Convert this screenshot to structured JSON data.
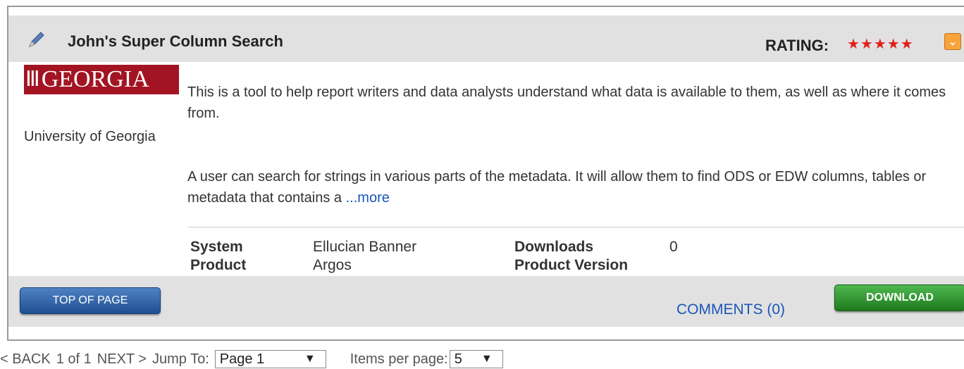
{
  "card": {
    "title": "John's Super Column Search",
    "rating_label": "RATING:",
    "rating_stars": 5,
    "stars_text": "★★★★★",
    "logo_text": "GEORGIA",
    "organization": "University of Georgia",
    "description_1": "This is a tool to help report writers and data analysts understand what data is available to them, as well as where it comes from.",
    "description_2": "A user can search for strings in various parts of the metadata. It will allow them to find ODS or EDW columns, tables or metadata that contains a",
    "more_link": "...more",
    "info": {
      "system_label": "System",
      "system_value": "Ellucian Banner",
      "product_label": "Product",
      "product_value": "Argos",
      "downloads_label": "Downloads",
      "downloads_value": "0",
      "version_label": "Product Version",
      "version_value": ""
    }
  },
  "footer": {
    "top_button": "TOP OF PAGE",
    "comments_link": "COMMENTS (0)",
    "download_button": "DOWNLOAD"
  },
  "pager": {
    "back": "< BACK",
    "page_info": "1 of 1",
    "next": "NEXT >",
    "jump_label": "Jump To:",
    "jump_value": "Page 1",
    "items_label": "Items per page:",
    "items_value": "5"
  },
  "colors": {
    "header_bg": "#e1e1e1",
    "star": "#e0201b",
    "link": "#1a56b8",
    "brand_red": "#a31423",
    "top_button": "#2a5ea6",
    "download_button": "#2e8f2e"
  },
  "icons": {
    "edit": "pencil-icon",
    "expand": "expand-icon",
    "dropdown": "chevron-down-icon"
  }
}
